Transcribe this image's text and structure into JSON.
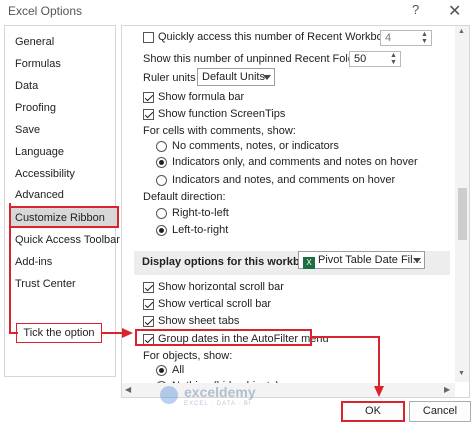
{
  "window": {
    "title": "Excel Options",
    "help": "?",
    "close": "✕"
  },
  "sidebar": {
    "items": [
      {
        "label": "General"
      },
      {
        "label": "Formulas"
      },
      {
        "label": "Data"
      },
      {
        "label": "Proofing"
      },
      {
        "label": "Save"
      },
      {
        "label": "Language"
      },
      {
        "label": "Accessibility"
      },
      {
        "label": "Advanced",
        "selected": true
      },
      {
        "label": "Customize Ribbon"
      },
      {
        "label": "Quick Access Toolbar"
      },
      {
        "label": "Add-ins"
      },
      {
        "label": "Trust Center"
      }
    ]
  },
  "options": {
    "recent_workbooks": {
      "label": "Quickly access this number of Recent Workbooks:",
      "checked": false,
      "value": "4"
    },
    "unpinned_folders": {
      "label": "Show this number of unpinned Recent Folders:",
      "value": "50"
    },
    "ruler_units": {
      "label": "Ruler units",
      "value": "Default Units"
    },
    "formula_bar": {
      "label": "Show formula bar",
      "checked": true
    },
    "screentips": {
      "label": "Show function ScreenTips",
      "checked": true
    },
    "comments": {
      "heading": "For cells with comments, show:",
      "options": [
        {
          "label": "No comments, notes, or indicators",
          "selected": false
        },
        {
          "label": "Indicators only, and comments and notes on hover",
          "selected": true
        },
        {
          "label": "Indicators and notes, and comments on hover",
          "selected": false
        }
      ]
    },
    "direction": {
      "heading": "Default direction:",
      "options": [
        {
          "label": "Right-to-left",
          "selected": false
        },
        {
          "label": "Left-to-right",
          "selected": true
        }
      ]
    },
    "workbook_section": {
      "label": "Display options for this workbook:",
      "value": "Pivot Table Date Fil..."
    },
    "h_scroll": {
      "label": "Show horizontal scroll bar",
      "checked": true
    },
    "v_scroll": {
      "label": "Show vertical scroll bar",
      "checked": true
    },
    "sheet_tabs": {
      "label": "Show sheet tabs",
      "checked": true
    },
    "group_dates": {
      "label": "Group dates in the AutoFilter menu",
      "checked": true
    },
    "objects": {
      "heading": "For objects, show:",
      "options": [
        {
          "label": "All",
          "selected": true
        },
        {
          "label": "Nothing (hide objects)",
          "selected": false
        }
      ]
    }
  },
  "buttons": {
    "ok": "OK",
    "cancel": "Cancel"
  },
  "annotation": {
    "callout": "Tick the option"
  },
  "watermark": {
    "name": "exceldemy",
    "tagline": "EXCEL · DATA · BI"
  },
  "colors": {
    "annotation": "#d9232f",
    "selected_item": "#d8d8d8",
    "excel_green": "#1d6f42"
  }
}
